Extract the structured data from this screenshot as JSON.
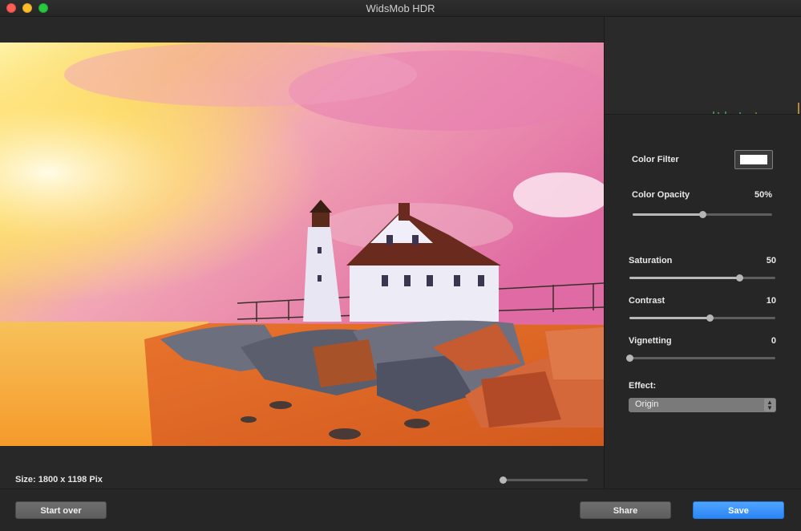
{
  "window": {
    "title": "WidsMob HDR"
  },
  "image_area": {
    "size_label": "Size: 1800 x 1198 Pix",
    "zoom_level": 0.0
  },
  "adjustments": {
    "color_filter": {
      "label": "Color Filter",
      "color": "#ffffff"
    },
    "color_opacity": {
      "label": "Color Opacity",
      "value": "50%",
      "level": 0.5
    },
    "saturation": {
      "label": "Saturation",
      "value": "50",
      "level": 0.75
    },
    "contrast": {
      "label": "Contrast",
      "value": "10",
      "level": 0.55
    },
    "vignetting": {
      "label": "Vignetting",
      "value": "0",
      "level": 0.0
    },
    "effect": {
      "label": "Effect:",
      "selected": "Origin"
    }
  },
  "buttons": {
    "start_over": "Start over",
    "share": "Share",
    "save": "Save"
  },
  "colors": {
    "accent": "#2b86f5",
    "background": "#262626"
  }
}
